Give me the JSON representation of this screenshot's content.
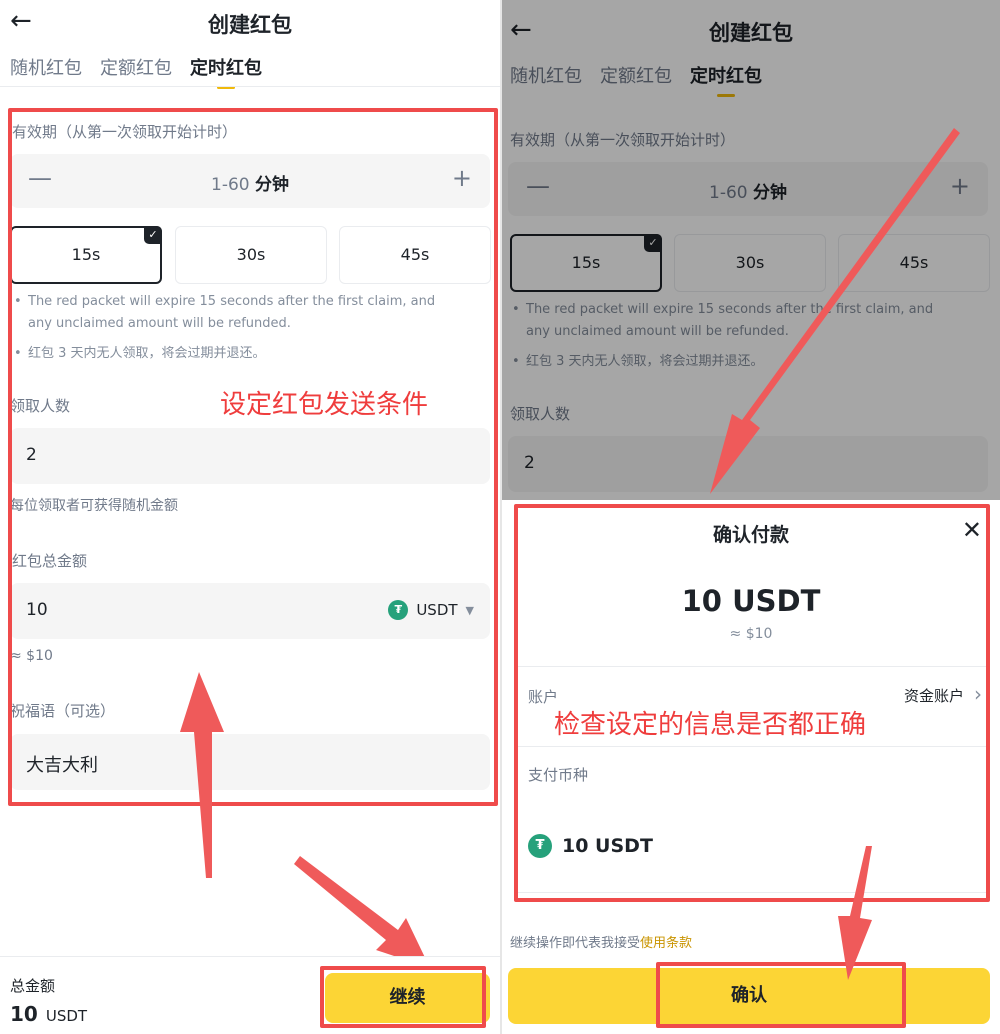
{
  "left": {
    "back_icon": "arrow-left-icon",
    "title": "创建红包",
    "tabs": [
      {
        "label": "随机红包",
        "active": false
      },
      {
        "label": "定额红包",
        "active": false
      },
      {
        "label": "定时红包",
        "active": true
      }
    ],
    "validity_label": "有效期（从第一次领取开始计时）",
    "stepper": {
      "minus": "—",
      "range": "1-60",
      "unit": "分钟",
      "plus": "+"
    },
    "options": [
      {
        "label": "15s",
        "selected": true
      },
      {
        "label": "30s",
        "selected": false
      },
      {
        "label": "45s",
        "selected": false
      }
    ],
    "notes": [
      "The red packet will expire 15 seconds after the first claim, and any unclaimed amount will be refunded.",
      "红包 3 天内无人领取，将会过期并退还。"
    ],
    "annotation": "设定红包发送条件",
    "recipients_label": "领取人数",
    "recipients_value": "2",
    "recipients_hint": "每位领取者可获得随机金额",
    "total_label": "红包总金额",
    "total_value": "10",
    "currency": "USDT",
    "total_approx": "≈ $10",
    "greeting_label": "祝福语（可选）",
    "greeting_value": "大吉大利",
    "bottom": {
      "total_label": "总金额",
      "total_value": "10",
      "total_unit": "USDT",
      "continue_label": "继续"
    }
  },
  "right": {
    "back_icon": "arrow-left-icon",
    "title": "创建红包",
    "tabs": [
      {
        "label": "随机红包",
        "active": false
      },
      {
        "label": "定额红包",
        "active": false
      },
      {
        "label": "定时红包",
        "active": true
      }
    ],
    "validity_label": "有效期（从第一次领取开始计时）",
    "stepper": {
      "minus": "—",
      "range": "1-60",
      "unit": "分钟",
      "plus": "+"
    },
    "options": [
      {
        "label": "15s",
        "selected": true
      },
      {
        "label": "30s",
        "selected": false
      },
      {
        "label": "45s",
        "selected": false
      }
    ],
    "notes": [
      "The red packet will expire 15 seconds after the first claim, and any unclaimed amount will be refunded.",
      "红包 3 天内无人领取，将会过期并退还。"
    ],
    "recipients_label": "领取人数",
    "recipients_value": "2",
    "sheet": {
      "title": "确认付款",
      "close_icon": "close-icon",
      "amount": "10 USDT",
      "approx": "≈ $10",
      "account_label": "账户",
      "account_value": "资金账户",
      "annotation": "检查设定的信息是否都正确",
      "pay_coin_label": "支付币种",
      "pay_coin_value": "10 USDT",
      "terms_prefix": "继续操作即代表我接受",
      "terms_link": "使用条款",
      "confirm_label": "确认"
    }
  },
  "colors": {
    "accent": "#fcd535",
    "annotation": "#ef4b4b",
    "coin": "#26a17b"
  }
}
